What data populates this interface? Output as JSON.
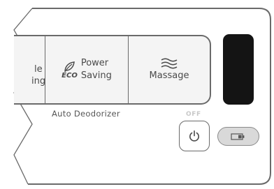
{
  "buttons": {
    "partial_top": "le",
    "partial_bottom": "ing",
    "eco_badge": "ECO",
    "power_saving_line1": "Power",
    "power_saving_line2": "Saving",
    "massage": "Massage"
  },
  "caption": "Auto Deodorizer",
  "power": {
    "off_label": "OFF"
  },
  "icons": {
    "eco": "leaf-icon",
    "massage": "wave-icon",
    "power": "power-icon",
    "battery": "battery-icon"
  },
  "colors": {
    "outline": "#6a6a6a",
    "display": "#141414",
    "pill": "#d9d9d9",
    "off_label": "#c8c8c8"
  }
}
